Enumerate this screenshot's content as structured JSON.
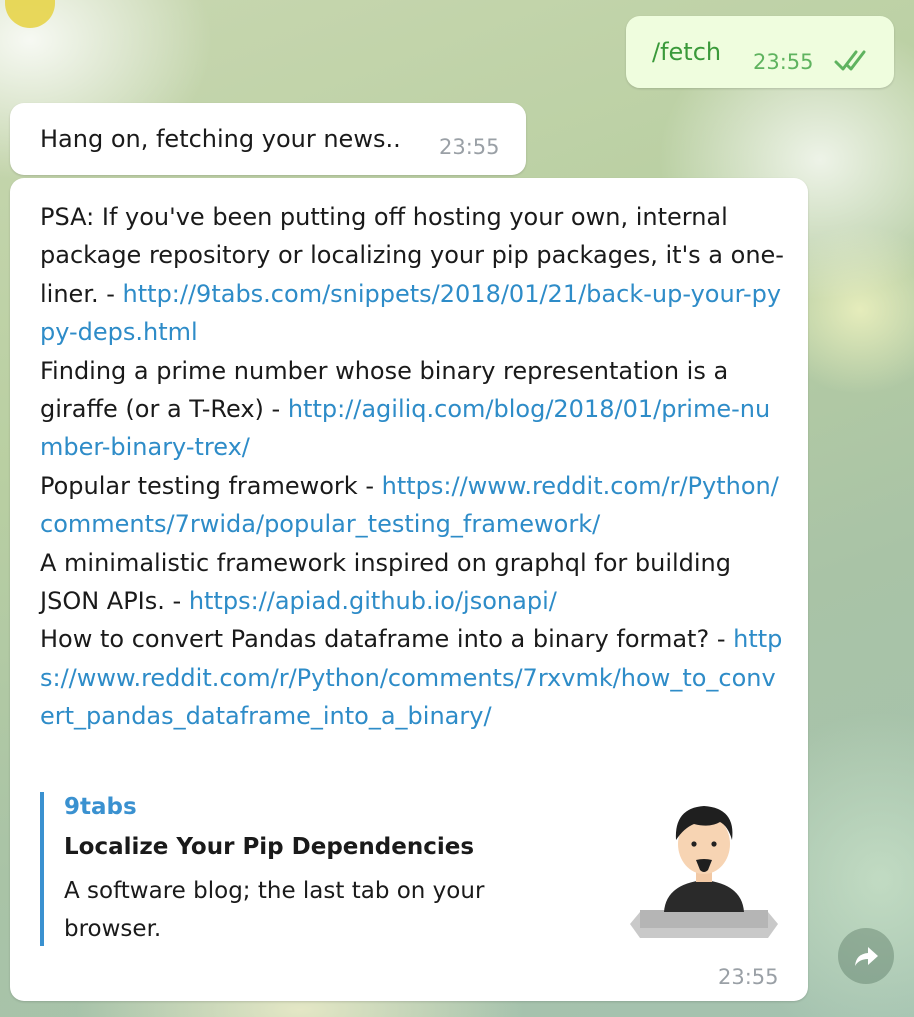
{
  "outgoing": {
    "text": "/fetch",
    "time": "23:55"
  },
  "incoming_status": {
    "text": "Hang on, fetching your news..",
    "time": "23:55"
  },
  "news_message": {
    "items": [
      {
        "text": "PSA: If you've been putting off hosting your own, internal package repository or localizing your pip packages, it's a one-liner. - ",
        "link": "http://9tabs.com/snippets/2018/01/21/back-up-your-pypy-deps.html"
      },
      {
        "text": "Finding a prime number whose binary representation is a giraffe (or a T-Rex) - ",
        "link": "http://agiliq.com/blog/2018/01/prime-number-binary-trex/"
      },
      {
        "text": "Popular testing framework - ",
        "link": "https://www.reddit.com/r/Python/comments/7rwida/popular_testing_framework/"
      },
      {
        "text": "A minimalistic framework inspired on graphql for building JSON APIs. - ",
        "link": "https://apiad.github.io/jsonapi/"
      },
      {
        "text": "How to convert Pandas dataframe into a binary format? - ",
        "link": "https://www.reddit.com/r/Python/comments/7rxvmk/how_to_convert_pandas_dataframe_into_a_binary/"
      }
    ],
    "preview": {
      "site": "9tabs",
      "title": "Localize Your Pip Dependencies",
      "description": "A software blog; the last tab on your browser."
    },
    "time": "23:55"
  },
  "icons": {
    "read_receipt": "double-check-icon",
    "share": "share-arrow-icon",
    "thumbnail": "avatar-illustration"
  },
  "colors": {
    "link": "#2e8cc8",
    "outgoing_bubble": "#effdde",
    "outgoing_text": "#3a9a3a",
    "preview_accent": "#3a91d0"
  }
}
